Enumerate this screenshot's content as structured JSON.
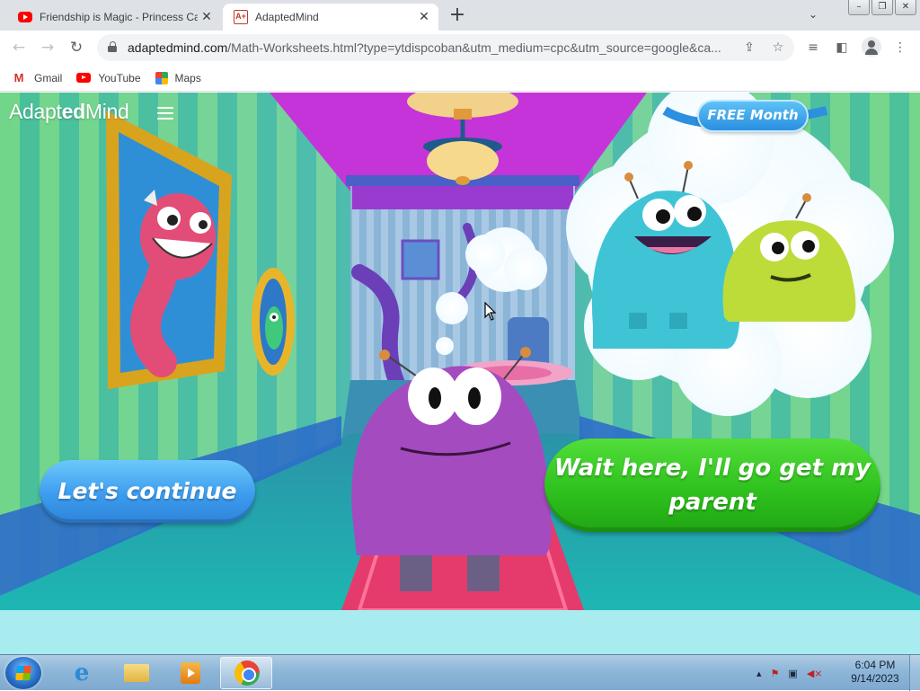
{
  "browser": {
    "tabs": [
      {
        "title": "Friendship is Magic - Princess Ca",
        "favicon": "youtube-icon",
        "active": false
      },
      {
        "title": "AdaptedMind",
        "favicon": "adaptedmind-icon",
        "favicon_text": "A+",
        "active": true
      }
    ],
    "new_tab_label": "+",
    "address": {
      "domain": "adaptedmind.com",
      "path": "/Math-Worksheets.html?type=ytdispcoban&utm_medium=cpc&utm_source=google&ca..."
    },
    "bookmarks": [
      {
        "label": "Gmail",
        "icon": "gmail-icon"
      },
      {
        "label": "YouTube",
        "icon": "youtube-icon"
      },
      {
        "label": "Maps",
        "icon": "maps-icon"
      }
    ]
  },
  "page": {
    "brand": {
      "part1": "Adapt",
      "part2": "ed",
      "part3": "Mind"
    },
    "free_month": "FREE Month",
    "continue_button": "Let's continue",
    "parent_button": "Wait here, I'll go get my parent"
  },
  "taskbar": {
    "time": "6:04 PM",
    "date": "9/14/2023"
  },
  "colors": {
    "page_bg": "#a8ecef",
    "continue_blue": "#3d9cee",
    "parent_green": "#2fc21e",
    "monster_purple": "#a44bc0",
    "monster_teal": "#3fc4d6",
    "monster_lime": "#bddc3a"
  }
}
